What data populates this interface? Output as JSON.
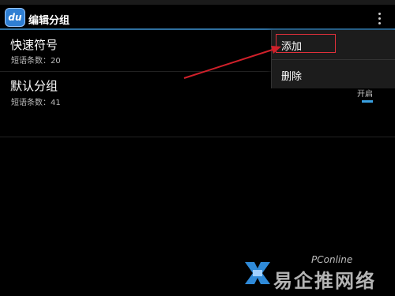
{
  "actionbar": {
    "app_icon_text": "du",
    "title": "编辑分组"
  },
  "groups": [
    {
      "name": "快速符号",
      "count_text": "短语条数：20"
    },
    {
      "name": "默认分组",
      "count_text": "短语条数：41"
    }
  ],
  "toggle": {
    "label": "开启"
  },
  "menu": {
    "items": [
      {
        "label": "添加"
      },
      {
        "label": "删除"
      }
    ]
  },
  "watermark": {
    "text": "易企推网络",
    "small": "PConline"
  },
  "colors": {
    "accent": "#2e6f9e",
    "highlight": "#e0303a",
    "arrow": "#d0202a",
    "toggle": "#3aa0e0"
  }
}
